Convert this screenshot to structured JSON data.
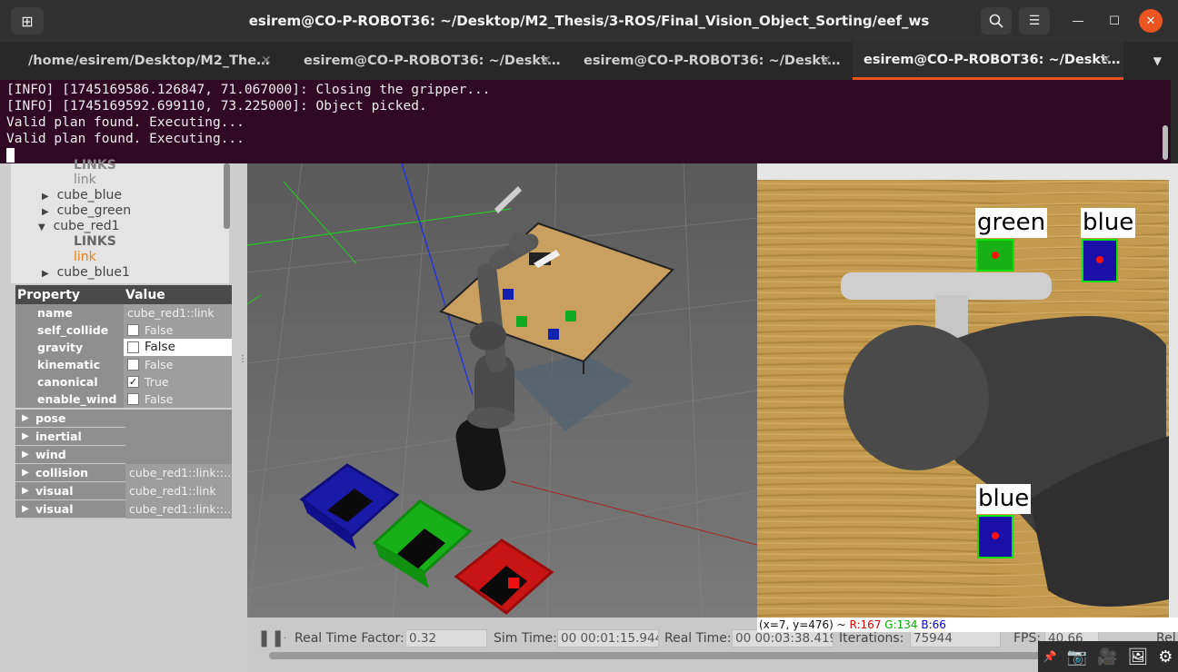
{
  "window": {
    "title": "esirem@CO-P-ROBOT36: ~/Desktop/M2_Thesis/3-ROS/Final_Vision_Object_Sorting/eef_ws"
  },
  "tabs": [
    {
      "label": "/home/esirem/Desktop/M2_The…"
    },
    {
      "label": "esirem@CO-P-ROBOT36: ~/Deskt…"
    },
    {
      "label": "esirem@CO-P-ROBOT36: ~/Deskt…"
    },
    {
      "label": "esirem@CO-P-ROBOT36: ~/Deskt…"
    }
  ],
  "terminal": {
    "lines": [
      "[INFO] [1745169586.126847, 71.067000]: Closing the gripper...",
      "[INFO] [1745169592.699110, 73.225000]: Object picked.",
      "Valid plan found. Executing...",
      "Valid plan found. Executing..."
    ]
  },
  "tree": {
    "items": [
      {
        "label": "LINKS"
      },
      {
        "label": "link"
      },
      {
        "label": "cube_blue"
      },
      {
        "label": "cube_green"
      },
      {
        "label": "cube_red1"
      },
      {
        "label": "LINKS"
      },
      {
        "label": "link"
      },
      {
        "label": "cube_blue1"
      }
    ]
  },
  "props": {
    "header": {
      "property": "Property",
      "value": "Value"
    },
    "rows": [
      {
        "key": "name",
        "value": "cube_red1::link"
      },
      {
        "key": "self_collide",
        "value": "False"
      },
      {
        "key": "gravity",
        "value": "False"
      },
      {
        "key": "kinematic",
        "value": "False"
      },
      {
        "key": "canonical",
        "value": "True"
      },
      {
        "key": "enable_wind",
        "value": "False"
      }
    ],
    "groups": [
      {
        "key": "pose",
        "value": ""
      },
      {
        "key": "inertial",
        "value": ""
      },
      {
        "key": "wind",
        "value": ""
      },
      {
        "key": "collision",
        "value": "cube_red1::link::…"
      },
      {
        "key": "visual",
        "value": "cube_red1::link"
      },
      {
        "key": "visual",
        "value": "cube_red1::link::…"
      }
    ]
  },
  "camera": {
    "labels": [
      "green",
      "blue",
      "blue"
    ],
    "pixel_readout": {
      "coords": "(x=7, y=476)",
      "sep": " ~ ",
      "r": "R:167",
      "g": "G:134",
      "b": "B:66"
    }
  },
  "status": {
    "rtf_label": "Real Time Factor:",
    "rtf_value": "0.32",
    "sim_label": "Sim Time:",
    "sim_value": "00 00:01:15.944",
    "real_label": "Real Time:",
    "real_value": "00 00:03:38.419",
    "iter_label": "Iterations:",
    "iter_value": "75944",
    "fps_label": "FPS:",
    "fps_value": "40.66",
    "reset_label": "Rel"
  },
  "colors": {
    "terminal_bg": "#300a24",
    "accent": "#e95420"
  }
}
